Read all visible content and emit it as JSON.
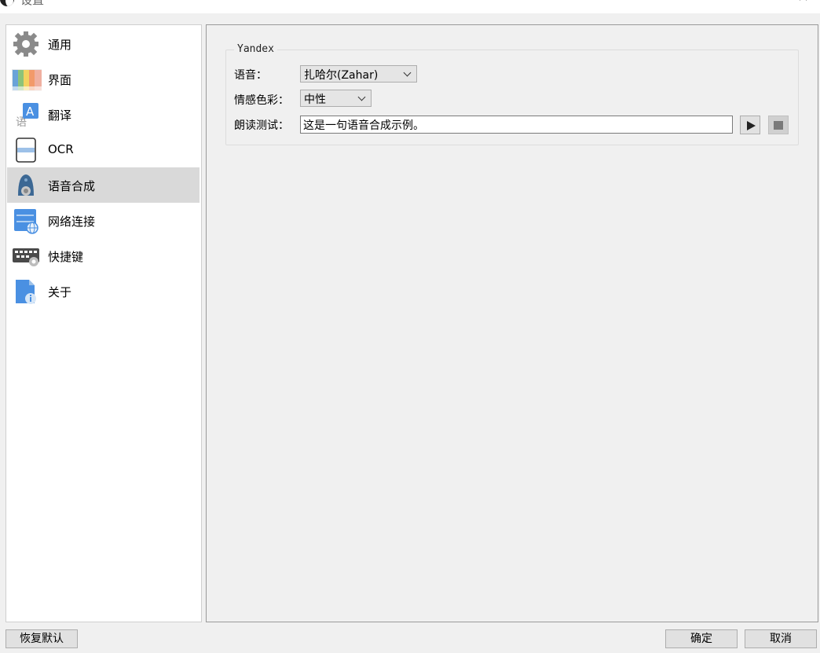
{
  "window": {
    "title": "设置",
    "help_glyph": "?",
    "close_glyph": "✕"
  },
  "sidebar": {
    "items": [
      {
        "label": "通用",
        "icon": "gear-icon"
      },
      {
        "label": "界面",
        "icon": "palette-icon"
      },
      {
        "label": "翻译",
        "icon": "translate-icon"
      },
      {
        "label": "OCR",
        "icon": "ocr-icon"
      },
      {
        "label": "语音合成",
        "icon": "speaker-icon",
        "selected": true
      },
      {
        "label": "网络连接",
        "icon": "network-icon"
      },
      {
        "label": "快捷键",
        "icon": "keyboard-icon"
      },
      {
        "label": "关于",
        "icon": "info-icon"
      }
    ]
  },
  "tts": {
    "group_title": "Yandex",
    "voice_label": "语音：",
    "voice_value": "扎哈尔(Zahar)",
    "emotion_label": "情感色彩：",
    "emotion_value": "中性",
    "test_label": "朗读测试：",
    "test_text": "这是一句语音合成示例。"
  },
  "footer": {
    "restore_label": "恢复默认",
    "ok_label": "确定",
    "cancel_label": "取消"
  }
}
